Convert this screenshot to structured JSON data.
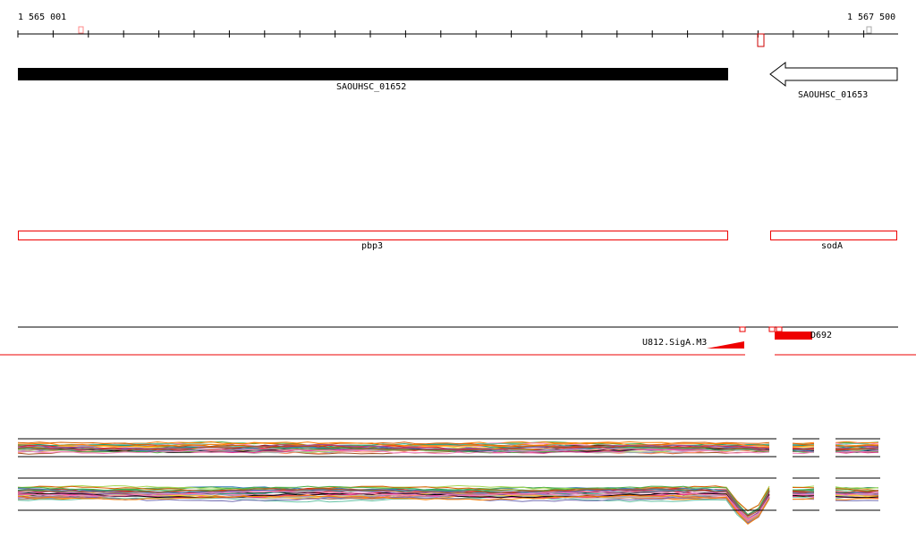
{
  "ruler": {
    "start_label": "1 565 001",
    "end_label": "1 567 500"
  },
  "genes_primary": [
    {
      "id": "SAOUHSC_01652",
      "strand": "+",
      "fill": "#000000"
    },
    {
      "id": "SAOUHSC_01653",
      "strand": "-",
      "fill": "#ffffff"
    }
  ],
  "genes_secondary": [
    {
      "name": "pbp3",
      "color": "#ff0000"
    },
    {
      "name": "sodA",
      "color": "#ff0000"
    }
  ],
  "features": [
    {
      "label": "U812.SigA.M3",
      "color": "#ff0000"
    },
    {
      "label": "D692",
      "color": "#ff0000"
    }
  ],
  "colors": {
    "accent": "#ff0000",
    "track": "#000000",
    "background": "#ffffff"
  },
  "expression": {
    "upper_lane": "profile-lines",
    "lower_lane": "profile-lines"
  }
}
